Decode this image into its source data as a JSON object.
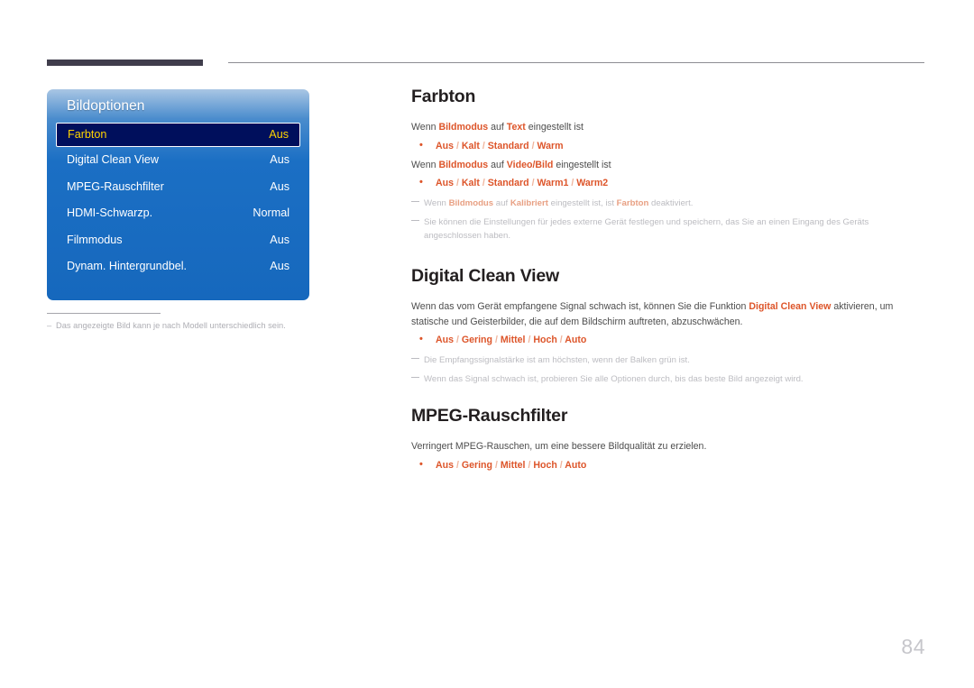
{
  "page": {
    "number": "84",
    "footnote_left": "Das angezeigte Bild kann je nach Modell unterschiedlich sein.",
    "footnote_dash": "–"
  },
  "osd": {
    "title": "Bildoptionen",
    "rows": [
      {
        "label": "Farbton",
        "value": "Aus",
        "selected": true
      },
      {
        "label": "Digital Clean View",
        "value": "Aus",
        "selected": false
      },
      {
        "label": "MPEG-Rauschfilter",
        "value": "Aus",
        "selected": false
      },
      {
        "label": "HDMI-Schwarzp.",
        "value": "Normal",
        "selected": false
      },
      {
        "label": "Filmmodus",
        "value": "Aus",
        "selected": false
      },
      {
        "label": "Dynam. Hintergrundbel.",
        "value": "Aus",
        "selected": false
      }
    ],
    "colors": {
      "panel_top": "#a9c6e4",
      "panel_body": "#1668bd",
      "selected_bg": "#000f5c",
      "selected_text": "#ffd400"
    }
  },
  "sections": {
    "farbton": {
      "title": "Farbton",
      "line1_a": "Wenn ",
      "line1_kw1": "Bildmodus",
      "line1_b": " auf ",
      "line1_kw2": "Text",
      "line1_c": " eingestellt ist",
      "options1": {
        "o1": "Aus",
        "o2": "Kalt",
        "o3": "Standard",
        "o4": "Warm"
      },
      "line2_a": "Wenn ",
      "line2_kw1": "Bildmodus",
      "line2_b": " auf ",
      "line2_kw2": "Video/Bild",
      "line2_c": " eingestellt ist",
      "options2": {
        "o1": "Aus",
        "o2": "Kalt",
        "o3": "Standard",
        "o4": "Warm1",
        "o5": "Warm2"
      },
      "note1_a": "Wenn ",
      "note1_kw1": "Bildmodus",
      "note1_b": " auf ",
      "note1_kw2": "Kalibriert",
      "note1_c": " eingestellt ist, ist ",
      "note1_kw3": "Farbton",
      "note1_d": " deaktiviert.",
      "note2": "Sie können die Einstellungen für jedes externe Gerät festlegen und speichern, das Sie an einen Eingang des Geräts angeschlossen haben."
    },
    "digital_clean_view": {
      "title": "Digital Clean View",
      "body_a": "Wenn das vom Gerät empfangene Signal schwach ist, können Sie die Funktion ",
      "body_kw": "Digital Clean View",
      "body_b": " aktivieren, um statische und Geisterbilder, die auf dem Bildschirm auftreten, abzuschwächen.",
      "options": {
        "o1": "Aus",
        "o2": "Gering",
        "o3": "Mittel",
        "o4": "Hoch",
        "o5": "Auto"
      },
      "note1": "Die Empfangssignalstärke ist am höchsten, wenn der Balken grün ist.",
      "note2": "Wenn das Signal schwach ist, probieren Sie alle Optionen durch, bis das beste Bild angezeigt wird."
    },
    "mpeg": {
      "title": "MPEG-Rauschfilter",
      "body": "Verringert MPEG-Rauschen, um eine bessere Bildqualität zu erzielen.",
      "options": {
        "o1": "Aus",
        "o2": "Gering",
        "o3": "Mittel",
        "o4": "Hoch",
        "o5": "Auto"
      }
    }
  },
  "separators": {
    "slash": " / "
  }
}
